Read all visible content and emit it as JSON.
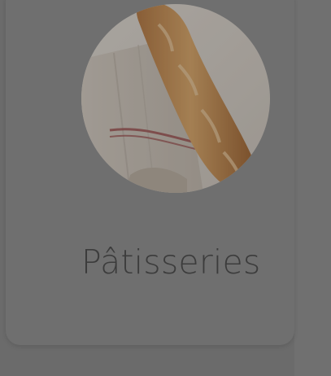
{
  "category_card": {
    "title": "Pâtisseries",
    "image_subject": "baguette-on-linen-cloth"
  },
  "colors": {
    "overlay_background": "#6b6b6b",
    "card_background": "#6f6f6f",
    "title_text": "#3c3c3c"
  }
}
